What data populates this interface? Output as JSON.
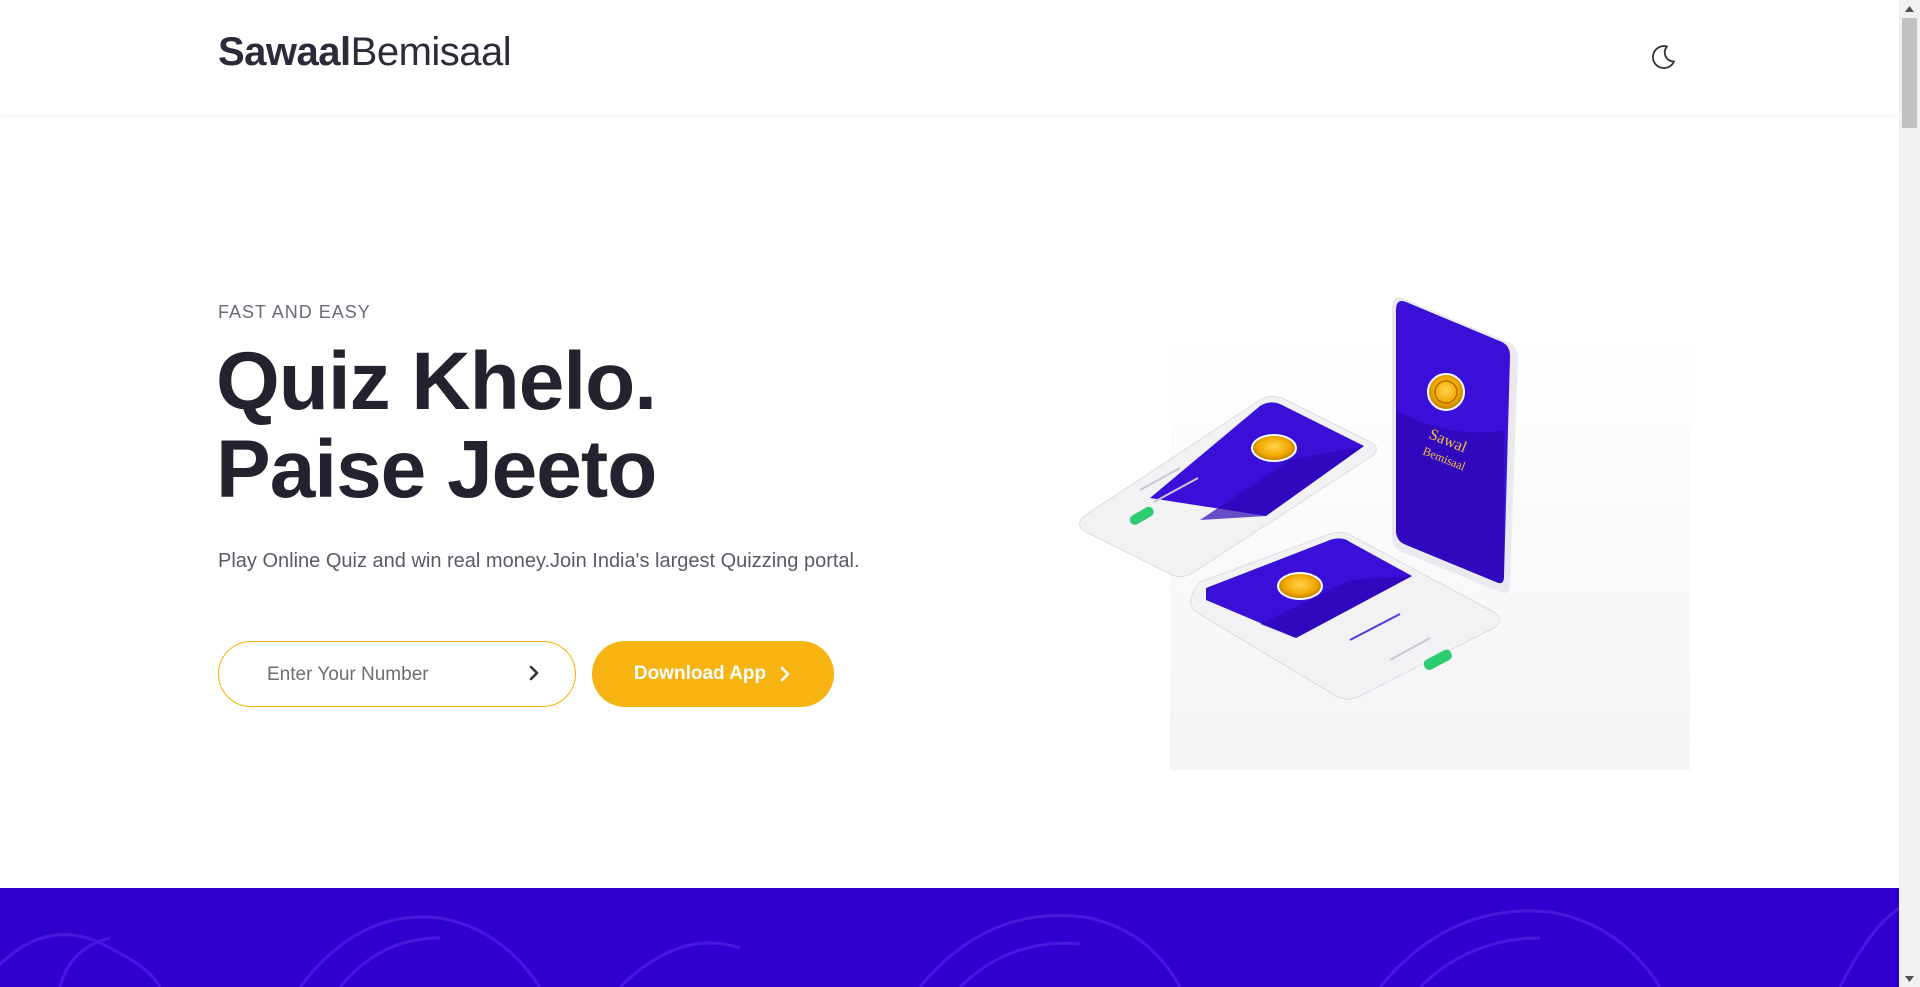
{
  "header": {
    "logo_bold": "Sawaal",
    "logo_light": "Bemisaal",
    "theme_toggle_icon": "moon-icon"
  },
  "hero": {
    "eyebrow": "FAST AND EASY",
    "headline_line1": "Quiz Khelo.",
    "headline_line2": "Paise Jeeto",
    "subtext": "Play Online Quiz and win real money.Join India's largest Quizzing portal.",
    "number_input": {
      "placeholder": "Enter Your Number",
      "value": "",
      "submit_icon": "chevron-right-icon"
    },
    "download_button": {
      "label": "Download App",
      "icon": "chevron-right-icon"
    }
  },
  "illustration": {
    "splash_title_line1": "Sawal",
    "splash_title_line2": "Bemisaal"
  },
  "colors": {
    "accent": "#f6b312",
    "brand_purple": "#3000cf",
    "text_dark": "#23232f",
    "green": "#2ecc71"
  }
}
